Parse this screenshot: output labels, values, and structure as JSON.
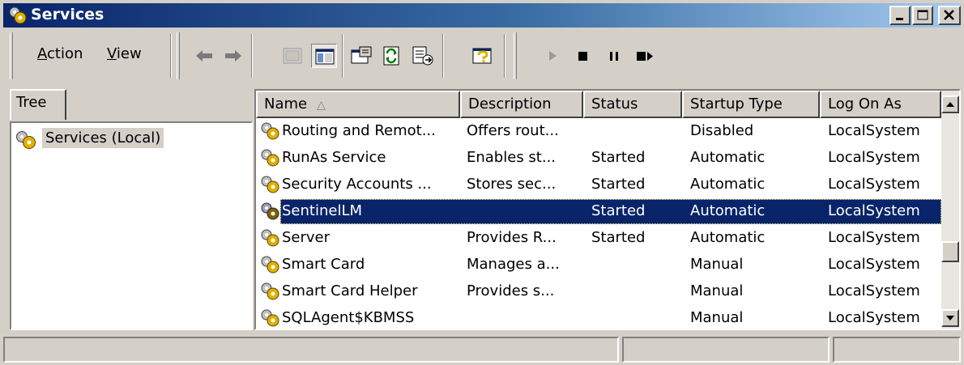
{
  "window": {
    "title": "Services",
    "title_icon": "services-gear-icon",
    "controls": [
      "minimize-icon",
      "maximize-icon",
      "close-icon"
    ]
  },
  "menu": {
    "action": {
      "prefix": "",
      "hotkey": "A",
      "rest": "ction"
    },
    "view": {
      "prefix": "",
      "hotkey": "V",
      "rest": "iew"
    }
  },
  "toolbar": {
    "icons": [
      "back-arrow-icon",
      "forward-arrow-icon",
      "up-level-icon",
      "show-hide-tree-icon",
      "properties-icon",
      "refresh-icon",
      "export-list-icon",
      "help-icon",
      "start-service-icon",
      "stop-service-icon",
      "pause-service-icon",
      "restart-service-icon"
    ]
  },
  "tree": {
    "tab_label": "Tree",
    "root_label": "Services (Local)"
  },
  "list": {
    "columns": [
      "Name",
      "Description",
      "Status",
      "Startup Type",
      "Log On As"
    ],
    "sort_column": "Name",
    "rows": [
      {
        "name": "Routing and Remot...",
        "description": "Offers rout...",
        "status": "",
        "startup": "Disabled",
        "logon": "LocalSystem"
      },
      {
        "name": "RunAs Service",
        "description": "Enables st...",
        "status": "Started",
        "startup": "Automatic",
        "logon": "LocalSystem"
      },
      {
        "name": "Security Accounts ...",
        "description": "Stores sec...",
        "status": "Started",
        "startup": "Automatic",
        "logon": "LocalSystem"
      },
      {
        "name": "SentinelLM",
        "description": "",
        "status": "Started",
        "startup": "Automatic",
        "logon": "LocalSystem",
        "selected": true
      },
      {
        "name": "Server",
        "description": "Provides R...",
        "status": "Started",
        "startup": "Automatic",
        "logon": "LocalSystem"
      },
      {
        "name": "Smart Card",
        "description": "Manages a...",
        "status": "",
        "startup": "Manual",
        "logon": "LocalSystem"
      },
      {
        "name": "Smart Card Helper",
        "description": "Provides s...",
        "status": "",
        "startup": "Manual",
        "logon": "LocalSystem"
      },
      {
        "name": "SQLAgent$KBMSS",
        "description": "",
        "status": "",
        "startup": "Manual",
        "logon": "LocalSystem"
      }
    ]
  },
  "colors": {
    "titlebar_start": "#0a246a",
    "titlebar_end": "#a6caf0",
    "selection": "#0a246a",
    "face": "#d4d0c8"
  }
}
